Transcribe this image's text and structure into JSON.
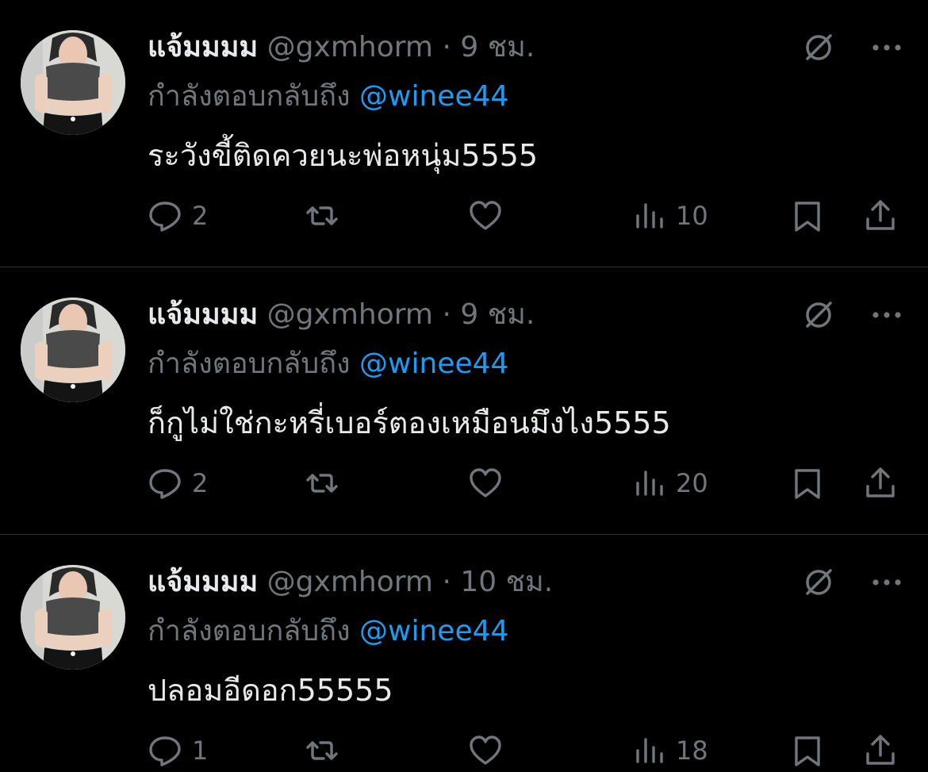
{
  "tweets": [
    {
      "name": "แจ้มมมม",
      "handle": "@gxmhorm",
      "separator": "·",
      "time": "9 ชม.",
      "reply_prefix": "กำลังตอบกลับถึง",
      "reply_to": "@winee44",
      "text": "ระวังขี้ติดควยนะพ่อหนุ่ม5555",
      "replies": "2",
      "retweets": "",
      "likes": "",
      "views": "10"
    },
    {
      "name": "แจ้มมมม",
      "handle": "@gxmhorm",
      "separator": "·",
      "time": "9 ชม.",
      "reply_prefix": "กำลังตอบกลับถึง",
      "reply_to": "@winee44",
      "text": "ก็กูไม่ใช่กะหรี่เบอร์ตองเหมือนมึงไง5555",
      "replies": "2",
      "retweets": "",
      "likes": "",
      "views": "20"
    },
    {
      "name": "แจ้มมมม",
      "handle": "@gxmhorm",
      "separator": "·",
      "time": "10 ชม.",
      "reply_prefix": "กำลังตอบกลับถึง",
      "reply_to": "@winee44",
      "text": "ปลอมอีดอก55555",
      "replies": "1",
      "retweets": "",
      "likes": "",
      "views": "18"
    }
  ],
  "icons": {
    "avatar": "profile-photo",
    "grok": "grok-icon",
    "more": "more-icon",
    "reply": "reply-icon",
    "retweet": "retweet-icon",
    "like": "heart-icon",
    "views": "views-icon",
    "bookmark": "bookmark-icon",
    "share": "share-icon"
  },
  "colors": {
    "background": "#000000",
    "text": "#e7e9ea",
    "muted": "#71767b",
    "link": "#1d9bf0",
    "divider": "#2f3336"
  }
}
